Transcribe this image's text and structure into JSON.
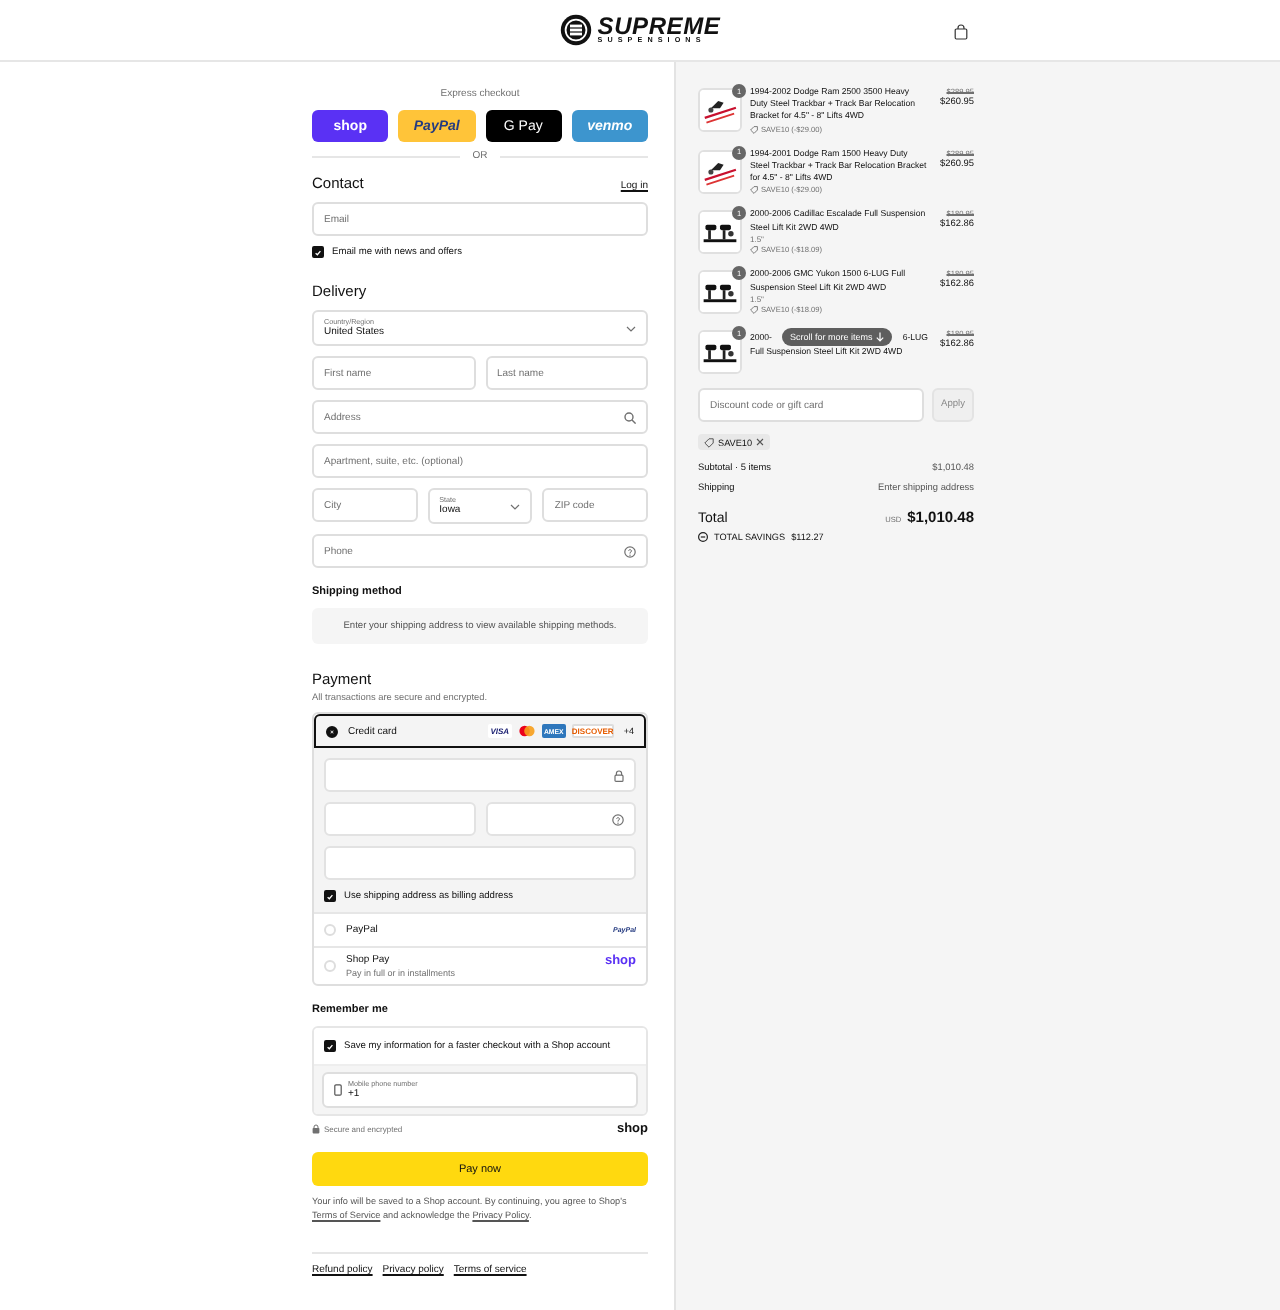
{
  "header": {
    "logo_title": "SUPREME",
    "logo_subtitle": "SUSPENSIONS"
  },
  "express": {
    "label": "Express checkout",
    "divider": "OR",
    "buttons": [
      {
        "kind": "shop",
        "label": "shop"
      },
      {
        "kind": "paypal",
        "label": "PayPal"
      },
      {
        "kind": "gpay",
        "label": "G Pay"
      },
      {
        "kind": "venmo",
        "label": "venmo"
      }
    ]
  },
  "contact": {
    "title": "Contact",
    "login": "Log in",
    "email": {
      "placeholder": "Email"
    },
    "newsletter": {
      "label": "Email me with news and offers",
      "checked": true
    }
  },
  "delivery": {
    "title": "Delivery",
    "country": {
      "label": "Country/Region",
      "value": "United States"
    },
    "first_name": {
      "placeholder": "First name"
    },
    "last_name": {
      "placeholder": "Last name"
    },
    "address": {
      "placeholder": "Address"
    },
    "apartment": {
      "placeholder": "Apartment, suite, etc. (optional)"
    },
    "city": {
      "placeholder": "City"
    },
    "state": {
      "label": "State",
      "value": "Iowa"
    },
    "zip": {
      "placeholder": "ZIP code"
    },
    "phone": {
      "placeholder": "Phone"
    }
  },
  "shipping_method": {
    "title": "Shipping method",
    "notice": "Enter your shipping address to view available shipping methods."
  },
  "payment": {
    "title": "Payment",
    "subtitle": "All transactions are secure and encrypted.",
    "methods": [
      {
        "kind": "card",
        "label": "Credit card",
        "selected": true,
        "brands": [
          {
            "kind": "visa",
            "label": "VISA"
          },
          {
            "kind": "mastercard"
          },
          {
            "kind": "amex",
            "label": "AMEX"
          },
          {
            "kind": "discover",
            "label": "DISCOVER"
          }
        ],
        "more": "+4",
        "billing": {
          "label": "Use shipping address as billing address",
          "checked": true
        }
      },
      {
        "kind": "paypal",
        "label": "PayPal",
        "selected": false,
        "logo": "PayPal"
      },
      {
        "kind": "shoppay",
        "label": "Shop Pay",
        "sublabel": "Pay in full or in installments",
        "selected": false,
        "logo": "shop"
      }
    ]
  },
  "remember": {
    "title": "Remember me",
    "save": {
      "label": "Save my information for a faster checkout with a Shop account",
      "checked": true
    },
    "phone": {
      "label": "Mobile phone number",
      "value": "+1"
    },
    "secure": "Secure and encrypted",
    "logo": "shop"
  },
  "pay_button": "Pay now",
  "notice": {
    "before": "Your info will be saved to a Shop account. By continuing, you agree to Shop's ",
    "link1": "Terms of Service",
    "middle": " and acknowledge the ",
    "link2": "Privacy Policy",
    "after": "."
  },
  "footer_links": [
    "Refund policy",
    "Privacy policy",
    "Terms of service"
  ],
  "summary": {
    "items": [
      {
        "kind": "full",
        "quantity": "1",
        "title": "1994-2002 Dodge Ram 2500 3500 Heavy Duty Steel Trackbar + Track Bar Relocation Bracket for 4.5\" - 8\" Lifts 4WD",
        "discount": "SAVE10 (-$29.00)",
        "old_price": "$289.95",
        "price": "$260.95"
      },
      {
        "kind": "full",
        "quantity": "1",
        "title": "1994-2001 Dodge Ram 1500 Heavy Duty Steel Trackbar + Track Bar Relocation Bracket for 4.5\" - 8\" Lifts 4WD",
        "discount": "SAVE10 (-$29.00)",
        "old_price": "$289.95",
        "price": "$260.95"
      },
      {
        "kind": "full",
        "quantity": "1",
        "title": "2000-2006 Cadillac Escalade Full Suspension Steel Lift Kit 2WD 4WD",
        "variant": "1.5\"",
        "discount": "SAVE10 (-$18.09)",
        "old_price": "$180.95",
        "price": "$162.86"
      },
      {
        "kind": "full",
        "quantity": "1",
        "title": "2000-2006 GMC Yukon 1500 6-LUG Full Suspension Steel Lift Kit 2WD 4WD",
        "variant": "1.5\"",
        "discount": "SAVE10 (-$18.09)",
        "old_price": "$180.95",
        "price": "$162.86"
      },
      {
        "kind": "covered",
        "quantity": "1",
        "title_start": "2000-",
        "title_end": "6-LUG",
        "title_line2": "Full Suspension Steel Lift Kit 2WD 4WD",
        "old_price": "$180.95",
        "price": "$162.86"
      }
    ],
    "scroll_hint": "Scroll for more items",
    "discount_field": {
      "placeholder": "Discount code or gift card"
    },
    "apply": "Apply",
    "tag": "SAVE10",
    "subtotal_label": "Subtotal · 5 items",
    "subtotal": "$1,010.48",
    "shipping_label": "Shipping",
    "shipping": "Enter shipping address",
    "total_label": "Total",
    "currency": "USD",
    "total": "$1,010.48",
    "savings_label": "TOTAL SAVINGS",
    "savings": "$112.27"
  }
}
